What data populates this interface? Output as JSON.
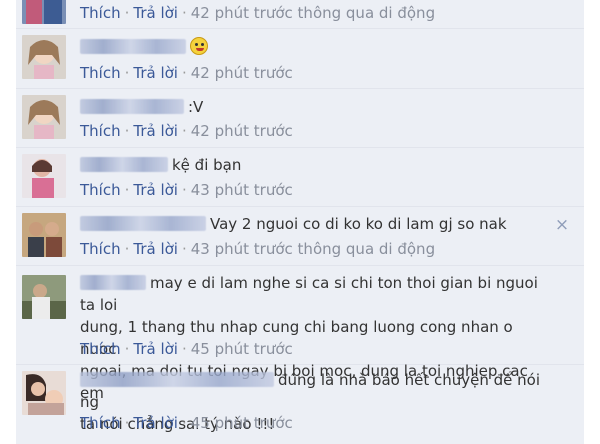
{
  "actions": {
    "like": "Thích",
    "reply": "Trả lời",
    "sep": "·"
  },
  "comments": [
    {
      "time": "42 phút trước thông qua di động",
      "avatar_icon": "avatar-icon"
    },
    {
      "text": "",
      "emoticon": "tongue-emoticon-icon",
      "time": "42 phút trước"
    },
    {
      "text": ":V",
      "time": "42 phút trước"
    },
    {
      "text": "kệ đi bạn",
      "time": "43 phút trước"
    },
    {
      "text": "Vay 2 nguoi co di ko ko di lam gj so nak",
      "time": "43 phút trước thông qua di động",
      "remove_icon": "×"
    },
    {
      "lines": [
        "may e di lam nghe si ca si chi ton thoi gian bi nguoi ta loi",
        "dung, 1 thang thu nhap cung chi bang luong cong nhan o nuoc",
        "ngoai, ma doi tu toi ngay bi boi moc, dung la toi nghiep cac em"
      ],
      "time": "45 phút trước"
    },
    {
      "lines": [
        "đúng là nhà báo hết chuyện để nói ng",
        "ta nói chẳng sai tý nào !!!"
      ],
      "time": "45 phút trước"
    }
  ],
  "colors": {
    "link": "#3b5998",
    "meta": "#898f9c",
    "bg": "#eceff5"
  }
}
